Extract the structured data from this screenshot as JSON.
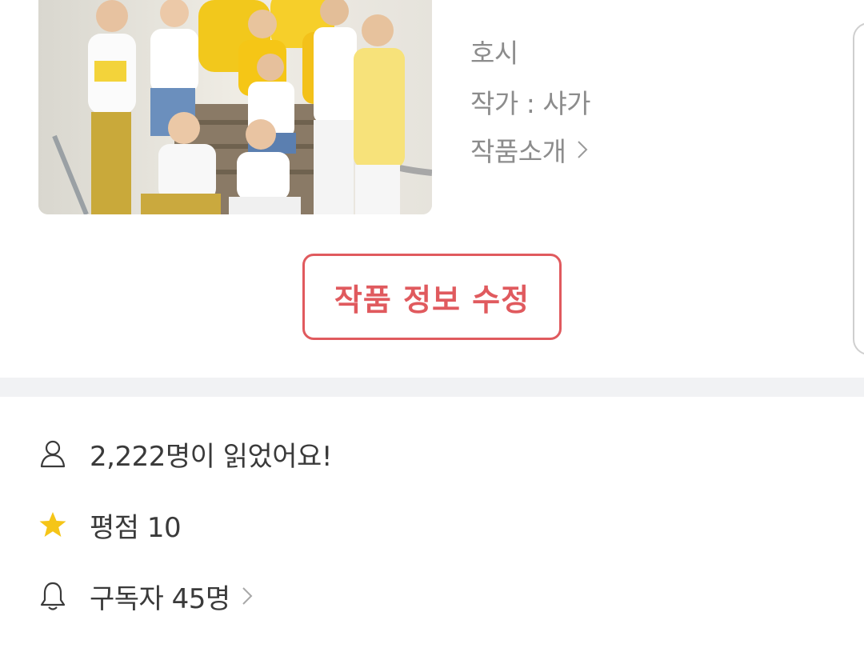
{
  "work": {
    "title": "호시",
    "author_line": "작가 : 샤가",
    "intro_link": "작품소개",
    "edit_button": "작품 정보 수정"
  },
  "stats": {
    "readers": "2,222명이 읽었어요!",
    "rating": "평점 10",
    "subscribers": "구독자 45명"
  },
  "icons": {
    "readers": "person-icon",
    "rating": "star-icon",
    "subscribers": "bell-icon",
    "chevron": "chevron-right-icon"
  },
  "colors": {
    "accent": "#e05a5e",
    "star": "#f5c518",
    "muted_text": "#8c8c8c",
    "divider": "#f1f2f4"
  }
}
